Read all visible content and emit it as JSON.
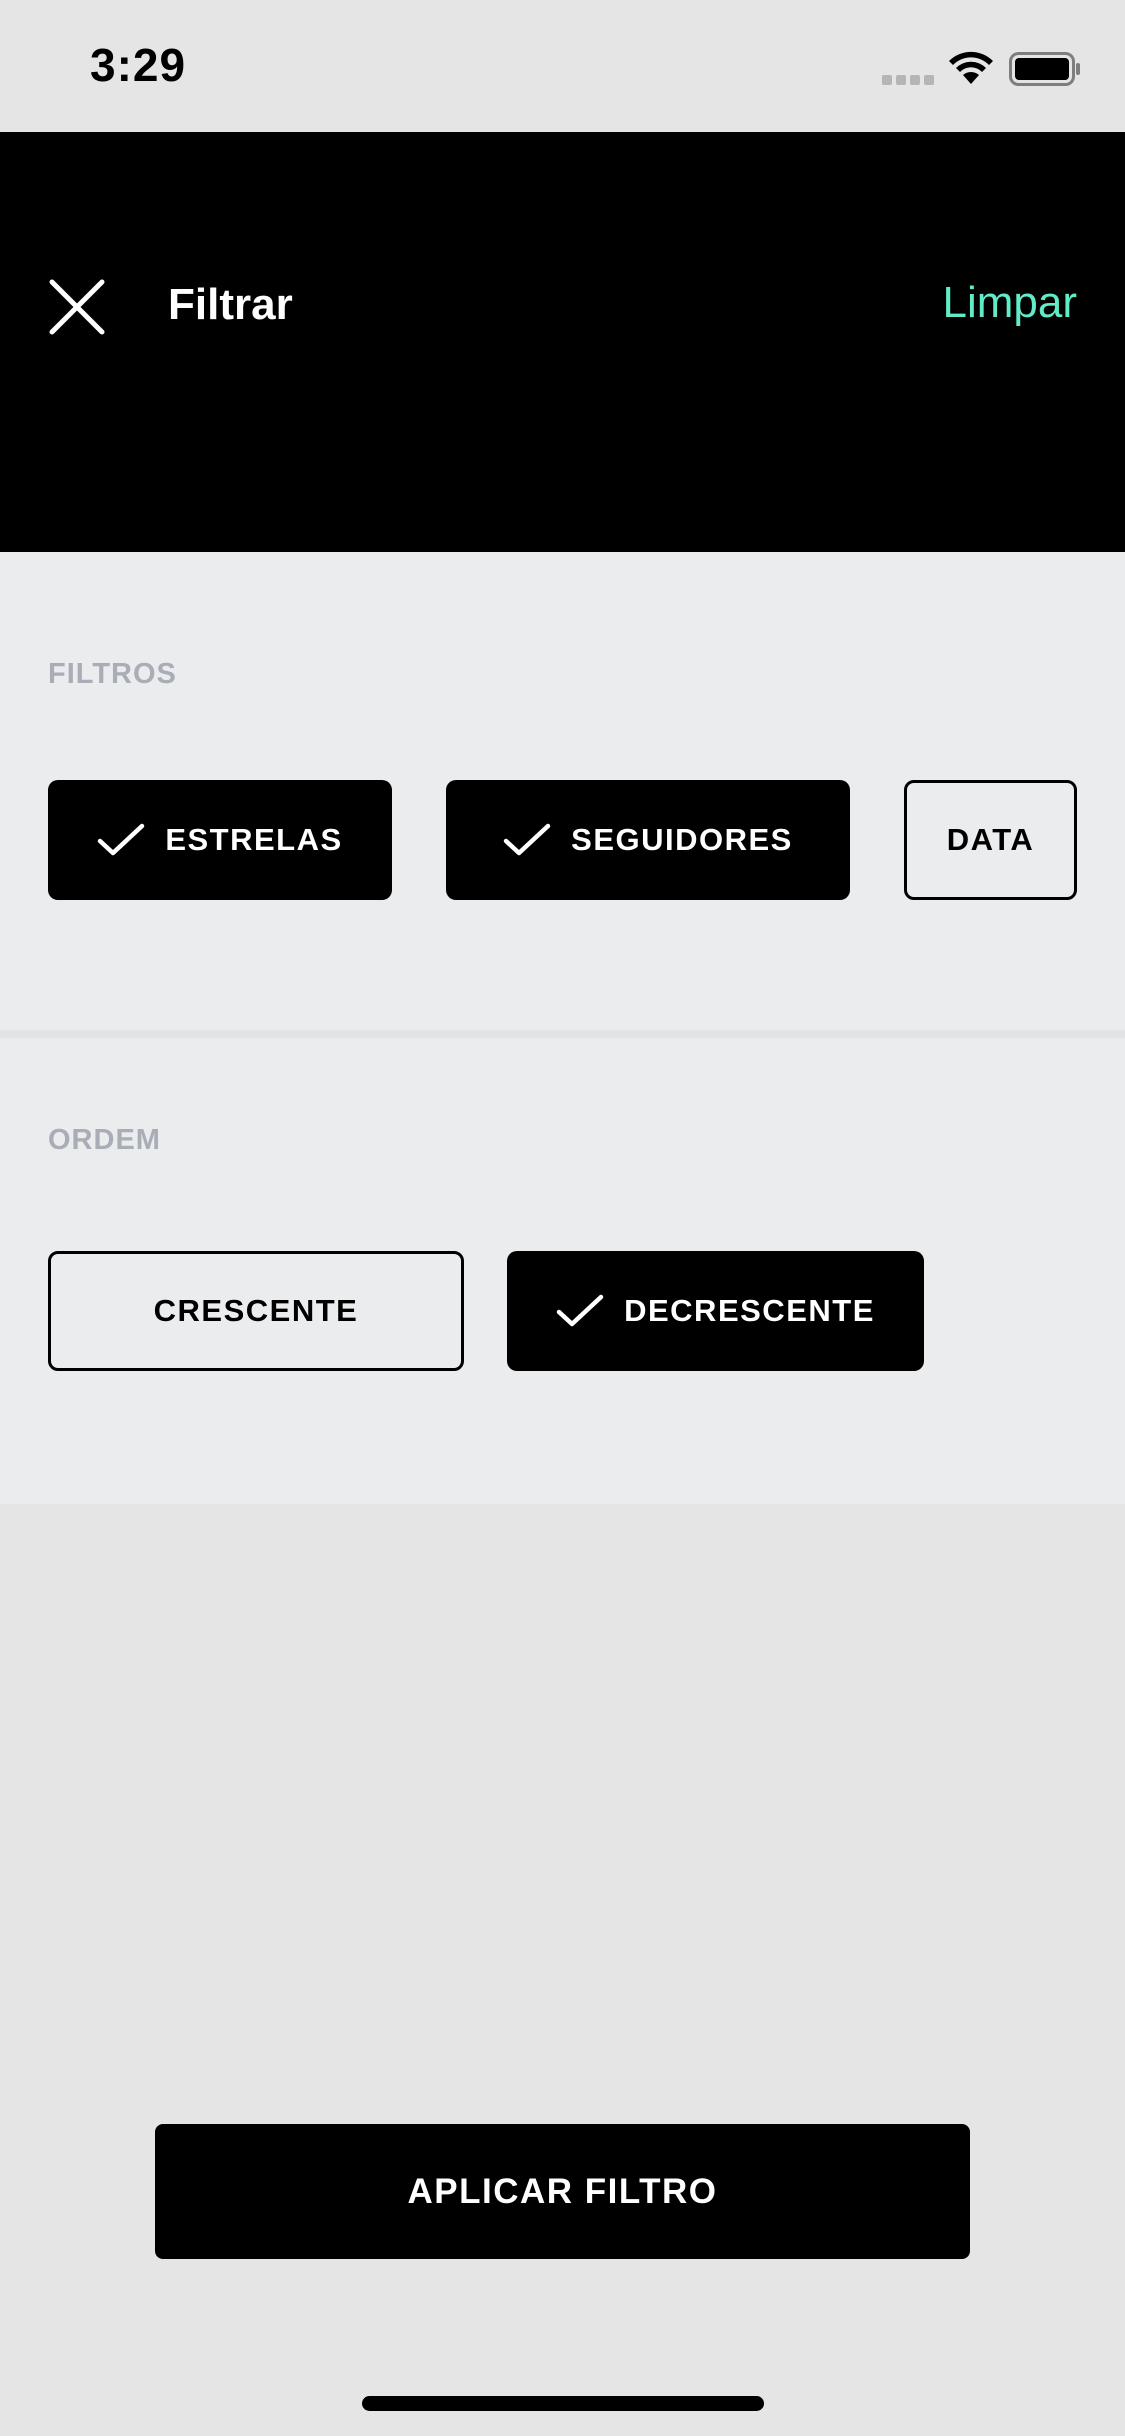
{
  "status_bar": {
    "time": "3:29",
    "signal_icon": "cellular-signal-icon",
    "wifi_icon": "wifi-icon",
    "battery_icon": "battery-icon"
  },
  "header": {
    "close_icon": "close-icon",
    "title": "Filtrar",
    "clear_label": "Limpar",
    "clear_color": "#62ebc8",
    "background_color": "#000000"
  },
  "filters": {
    "label": "FILTROS",
    "chips": [
      {
        "label": "ESTRELAS",
        "selected": true
      },
      {
        "label": "SEGUIDORES",
        "selected": true
      },
      {
        "label": "DATA",
        "selected": false
      }
    ]
  },
  "order": {
    "label": "ORDEM",
    "chips": [
      {
        "label": "CRESCENTE",
        "selected": false
      },
      {
        "label": "DECRESCENTE",
        "selected": true
      }
    ]
  },
  "apply_button": {
    "label": "APLICAR FILTRO"
  },
  "colors": {
    "page_background": "#e5e5e5",
    "section_background": "#ebecee",
    "section_label": "#a9adb5",
    "selected_chip": "#000000"
  }
}
